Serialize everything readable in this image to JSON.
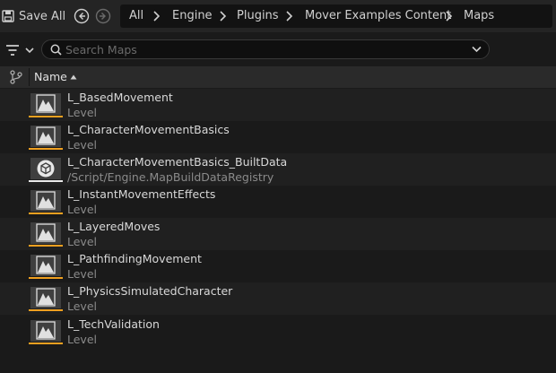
{
  "toolbar": {
    "save_all_label": "Save All"
  },
  "breadcrumb": [
    "All",
    "Engine",
    "Plugins",
    "Mover Examples Content",
    "Maps"
  ],
  "search": {
    "placeholder": "Search Maps",
    "value": ""
  },
  "columns": {
    "name": "Name"
  },
  "assets": [
    {
      "name": "L_BasedMovement",
      "type": "Level",
      "icon": "level-icon"
    },
    {
      "name": "L_CharacterMovementBasics",
      "type": "Level",
      "icon": "level-icon"
    },
    {
      "name": "L_CharacterMovementBasics_BuiltData",
      "type": "/Script/Engine.MapBuildDataRegistry",
      "icon": "build-data-icon"
    },
    {
      "name": "L_InstantMovementEffects",
      "type": "Level",
      "icon": "level-icon"
    },
    {
      "name": "L_LayeredMoves",
      "type": "Level",
      "icon": "level-icon"
    },
    {
      "name": "L_PathfindingMovement",
      "type": "Level",
      "icon": "level-icon"
    },
    {
      "name": "L_PhysicsSimulatedCharacter",
      "type": "Level",
      "icon": "level-icon"
    },
    {
      "name": "L_TechValidation",
      "type": "Level",
      "icon": "level-icon"
    }
  ],
  "colors": {
    "level_accent": "#f0a020",
    "data_accent": "#e8e8e8",
    "background": "#1a1a1a"
  }
}
